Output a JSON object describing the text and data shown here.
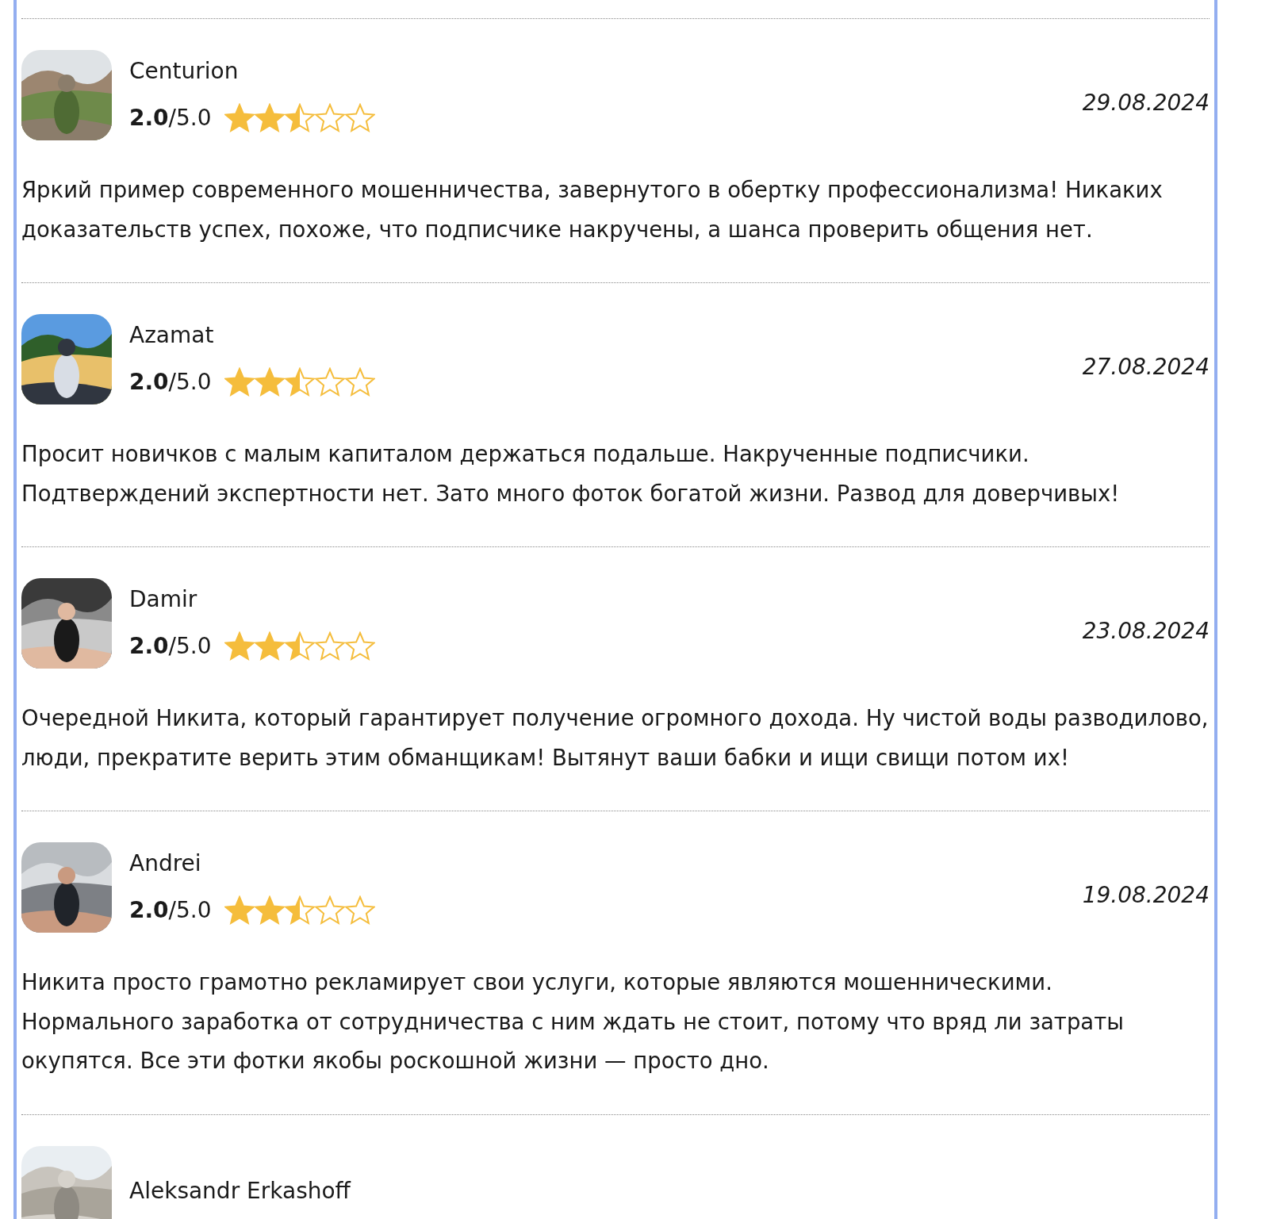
{
  "reviews": [
    {
      "name": "Centurion",
      "rating": "**2.0**/5.0",
      "stars": 2.5,
      "date": "29.08.2024",
      "text": "Яркий пример современного мошенничества, завернутого в обертку профессионализма! Никаких доказательств успех, похоже, что подписчике накручены, а шанса проверить общения нет."
    },
    {
      "name": "Azamat",
      "rating": "**2.0**/5.0",
      "stars": 2.5,
      "date": "27.08.2024",
      "text": "Просит новичков с малым капиталом держаться подальше. Накрученные подписчики. Подтверждений экспертности нет. Зато много фоток богатой жизни. Развод для доверчивых!"
    },
    {
      "name": "Damir",
      "rating": "**2.0**/5.0",
      "stars": 2.5,
      "date": "23.08.2024",
      "text": "Очередной Никита, который гарантирует получение огромного дохода. Ну чистой воды разводилово, люди, прекратите верить этим обманщикам! Вытянут ваши бабки и ищи свищи потом их!"
    },
    {
      "name": "Andrei",
      "rating": "**2.0**/5.0",
      "stars": 2.5,
      "date": "19.08.2024",
      "text": "Никита просто грамотно рекламирует свои услуги, которые являются мошенническими. Нормального заработка от сотрудничества с ним ждать не стоит, потому что вряд ли затраты окупятся. Все эти фотки якобы роскошной жизни — просто дно."
    },
    {
      "name": "Aleksandr Erkashoff"
    }
  ]
}
